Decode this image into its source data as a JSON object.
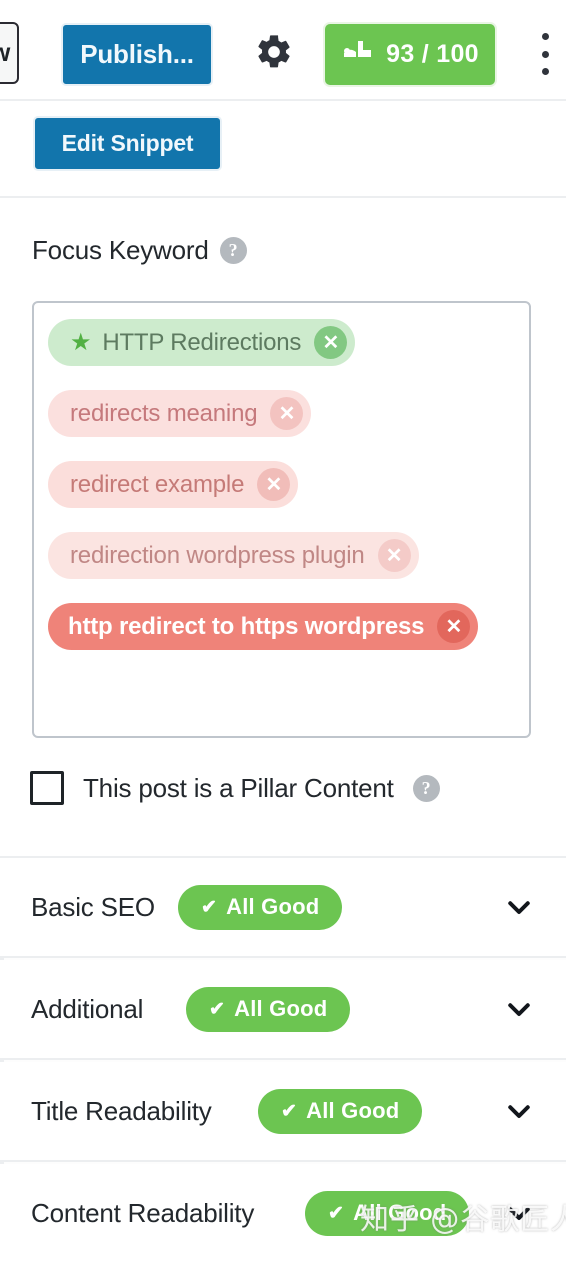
{
  "toolbar": {
    "preview_label": "ew",
    "publish_label": "Publish...",
    "settings_icon": "gear-icon",
    "score_value": "93 / 100",
    "score_icon": "rank-math-logo-icon",
    "more_icon": "kebab-menu-icon"
  },
  "snippet": {
    "edit_snippet_label": "Edit Snippet"
  },
  "focus_keyword": {
    "label": "Focus Keyword",
    "help_glyph": "?",
    "tags": [
      {
        "text": "HTTP Redirections",
        "star": "★",
        "close": "✕",
        "variant": "primary"
      },
      {
        "text": "redirects meaning",
        "close": "✕",
        "variant": "l1"
      },
      {
        "text": "redirect example",
        "close": "✕",
        "variant": "l2"
      },
      {
        "text": "redirection wordpress plugin",
        "close": "✕",
        "variant": "l3"
      },
      {
        "text": "http redirect to https wordpress",
        "close": "✕",
        "variant": "l4"
      }
    ],
    "pillar_label": "This post is a Pillar Content",
    "pillar_help_glyph": "?",
    "pillar_checked": false
  },
  "accordions": [
    {
      "title": "Basic SEO",
      "badge": "All Good",
      "tick": "✔",
      "chevron": "chevron-down-icon"
    },
    {
      "title": "Additional",
      "badge": "All Good",
      "tick": "✔",
      "chevron": "chevron-down-icon"
    },
    {
      "title": "Title Readability",
      "badge": "All Good",
      "tick": "✔",
      "chevron": "chevron-down-icon"
    },
    {
      "title": "Content Readability",
      "badge": "All Good",
      "tick": "✔",
      "chevron": "chevron-down-icon"
    }
  ],
  "watermark": {
    "text": "知乎 @谷歌匠人"
  },
  "colors": {
    "primary_blue": "#1275ac",
    "good_green": "#6cc551",
    "tag_green": "#cdebcd",
    "tag_red_strong": "#ef8379",
    "text_dark": "#23282d",
    "divider": "#eceef0"
  }
}
